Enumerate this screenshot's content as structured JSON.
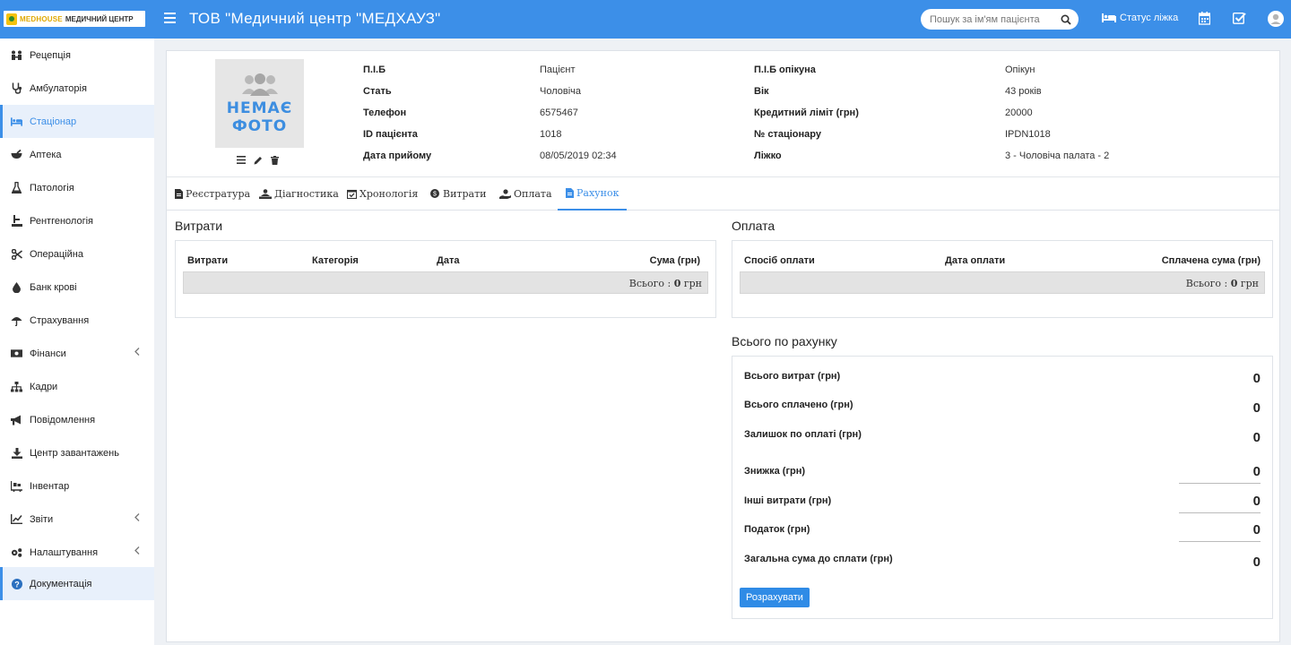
{
  "header": {
    "logo_brand": "MEDHOUSE",
    "logo_sub": "МЕДИЧНИЙ ЦЕНТР",
    "org_title": "ТОВ \"Медичний центр \"МЕДХАУЗ\"",
    "search_placeholder": "Пошук за ім'ям пацієнта",
    "bed_status": "Статус ліжка"
  },
  "sidebar": {
    "items": [
      {
        "label": "Рецепція",
        "icon": "reception-icon"
      },
      {
        "label": "Амбулаторія",
        "icon": "stethoscope-icon"
      },
      {
        "label": "Стаціонар",
        "icon": "bed-icon"
      },
      {
        "label": "Аптека",
        "icon": "mortar-icon"
      },
      {
        "label": "Патологія",
        "icon": "flask-icon"
      },
      {
        "label": "Рентгенологія",
        "icon": "xray-icon"
      },
      {
        "label": "Операційна",
        "icon": "scissors-icon"
      },
      {
        "label": "Банк крові",
        "icon": "drop-icon"
      },
      {
        "label": "Страхування",
        "icon": "umbrella-icon"
      },
      {
        "label": "Фінанси",
        "icon": "money-icon"
      },
      {
        "label": "Кадри",
        "icon": "sitemap-icon"
      },
      {
        "label": "Повідомлення",
        "icon": "bullhorn-icon"
      },
      {
        "label": "Центр завантажень",
        "icon": "download-icon"
      },
      {
        "label": "Інвентар",
        "icon": "inventory-icon"
      },
      {
        "label": "Звіти",
        "icon": "chart-icon"
      },
      {
        "label": "Налаштування",
        "icon": "gears-icon"
      },
      {
        "label": "Документація",
        "icon": "question-icon"
      }
    ]
  },
  "patient": {
    "photo_line1": "НЕМАЄ",
    "photo_line2": "ФОТО",
    "fields_left": [
      {
        "label": "П.І.Б",
        "value": "Пацієнт"
      },
      {
        "label": "Стать",
        "value": "Чоловіча"
      },
      {
        "label": "Телефон",
        "value": "6575467"
      },
      {
        "label": "ID пацієнта",
        "value": "1018"
      },
      {
        "label": "Дата прийому",
        "value": "08/05/2019 02:34"
      }
    ],
    "fields_right": [
      {
        "label": "П.І.Б опікуна",
        "value": "Опікун"
      },
      {
        "label": "Вік",
        "value": "43 років"
      },
      {
        "label": "Кредитний ліміт (грн)",
        "value": "20000"
      },
      {
        "label": "№ стаціонару",
        "value": "IPDN1018"
      },
      {
        "label": "Ліжко",
        "value": "3 - Чоловіча палата - 2"
      }
    ]
  },
  "tabs": [
    {
      "label": "Реєстратура",
      "icon": "file-icon"
    },
    {
      "label": "Діагностика",
      "icon": "diagnosis-icon"
    },
    {
      "label": "Хронологія",
      "icon": "calendar-check-icon"
    },
    {
      "label": "Витрати",
      "icon": "coins-icon"
    },
    {
      "label": "Оплата",
      "icon": "hand-money-icon"
    },
    {
      "label": "Рахунок",
      "icon": "invoice-icon"
    }
  ],
  "expenses": {
    "title": "Витрати",
    "columns": [
      "Витрати",
      "Категорія",
      "Дата",
      "Сума (грн)"
    ],
    "total_label": "Всього :",
    "total_value": "0",
    "currency": "грн"
  },
  "payment": {
    "title": "Оплата",
    "columns": [
      "Спосіб оплати",
      "Дата оплати",
      "Сплачена сума (грн)"
    ],
    "total_label": "Всього :",
    "total_value": "0",
    "currency": "грн"
  },
  "summary": {
    "title": "Всього по рахунку",
    "rows": [
      {
        "label": "Всього витрат (грн)",
        "value": "0"
      },
      {
        "label": "Всього сплачено (грн)",
        "value": "0"
      },
      {
        "label": "Залишок по оплаті (грн)",
        "value": "0"
      },
      {
        "label": "Знижка (грн)",
        "value": "0"
      },
      {
        "label": "Інші витрати (грн)",
        "value": "0"
      },
      {
        "label": "Податок (грн)",
        "value": "0"
      },
      {
        "label": "Загальна сума до сплати (грн)",
        "value": "0"
      }
    ],
    "button": "Розрахувати"
  },
  "colors": {
    "primary": "#3c8fe8",
    "sidebar_active_bg": "#e8f0fb"
  }
}
